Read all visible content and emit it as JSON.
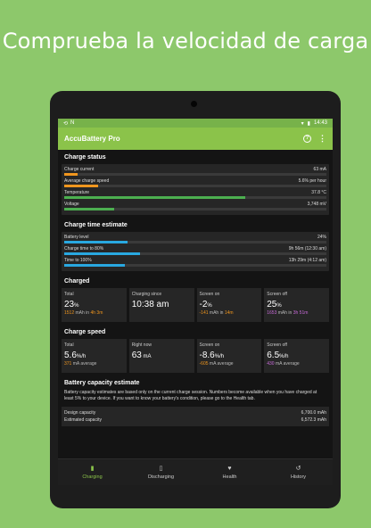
{
  "headline": "Comprueba la velocidad de carga",
  "status_bar": {
    "time": "14:43"
  },
  "app_bar": {
    "title": "AccuBattery Pro",
    "help_icon": "?",
    "menu_icon": "⋮"
  },
  "charge_status": {
    "title": "Charge status",
    "rows": [
      {
        "label": "Charge current",
        "value": "63 mA",
        "fill": 0.05,
        "color": "#f0961e"
      },
      {
        "label": "Average charge speed",
        "value": "5.6% per hour",
        "fill": 0.13,
        "color": "#f0961e"
      },
      {
        "label": "Temperature",
        "value": "37.8 °C",
        "fill": 0.69,
        "color": "#4caf50"
      },
      {
        "label": "Voltage",
        "value": "3,748 mV",
        "fill": 0.19,
        "color": "#4caf50"
      }
    ]
  },
  "charge_time": {
    "title": "Charge time estimate",
    "rows": [
      {
        "label": "Battery level",
        "value": "24%",
        "fill": 0.24,
        "color": "#29a8e0"
      },
      {
        "label": "Charge time to 80%",
        "value": "9h 56m (12:30 am)",
        "fill": 0.29,
        "color": "#29a8e0"
      },
      {
        "label": "Time to 100%",
        "value": "13h 29m (4:12 am)",
        "fill": 0.23,
        "color": "#29a8e0"
      }
    ]
  },
  "charged": {
    "title": "Charged",
    "tiles": [
      {
        "label": "Total",
        "value": "23",
        "unit": "%",
        "sub_a": "1512",
        "sub_b": " mAh in ",
        "sub_c": "4h 3m"
      },
      {
        "label": "Charging since",
        "value": "10:38 am",
        "unit": "",
        "sub_a": "",
        "sub_b": "",
        "sub_c": ""
      },
      {
        "label": "Screen on",
        "value": "-2",
        "unit": "%",
        "sub_a": "-141",
        "sub_b": " mAh in ",
        "sub_c": "14m"
      },
      {
        "label": "Screen off",
        "value": "25",
        "unit": "%",
        "sub_a": "1653",
        "sub_b": " mAh in ",
        "sub_c": "3h 51m"
      }
    ]
  },
  "charge_speed": {
    "title": "Charge speed",
    "tiles": [
      {
        "label": "Total",
        "value": "5.6",
        "unit": "%/h",
        "sub_a": "371",
        "sub_b": " mA average"
      },
      {
        "label": "Right now",
        "value": "63",
        "unit": " mA",
        "sub_a": "",
        "sub_b": ""
      },
      {
        "label": "Screen on",
        "value": "-8.6",
        "unit": "%/h",
        "sub_a": "-605",
        "sub_b": " mA average"
      },
      {
        "label": "Screen off",
        "value": "6.5",
        "unit": "%/h",
        "sub_a": "430",
        "sub_b": " mA average"
      }
    ]
  },
  "capacity": {
    "title": "Battery capacity estimate",
    "description": "Battery capacity estimates are based only on the current charge session. Numbers become available when you have charged at least 5% to your device. If you want to know your battery's condition, please go to the Health tab.",
    "rows": [
      {
        "label": "Design capacity",
        "value": "6,700.0 mAh"
      },
      {
        "label": "Estimated capacity",
        "value": "6,572.3 mAh"
      }
    ]
  },
  "bottom_nav": [
    {
      "label": "Charging",
      "icon": "battery-charging-icon",
      "active": true
    },
    {
      "label": "Discharging",
      "icon": "battery-icon",
      "active": false
    },
    {
      "label": "Health",
      "icon": "heart-icon",
      "active": false
    },
    {
      "label": "History",
      "icon": "history-icon",
      "active": false
    }
  ],
  "colors": {
    "background": "#8dc86b",
    "app_bar": "#8bc34a",
    "accent_orange": "#f0961e",
    "accent_purple": "#c86bd8"
  }
}
